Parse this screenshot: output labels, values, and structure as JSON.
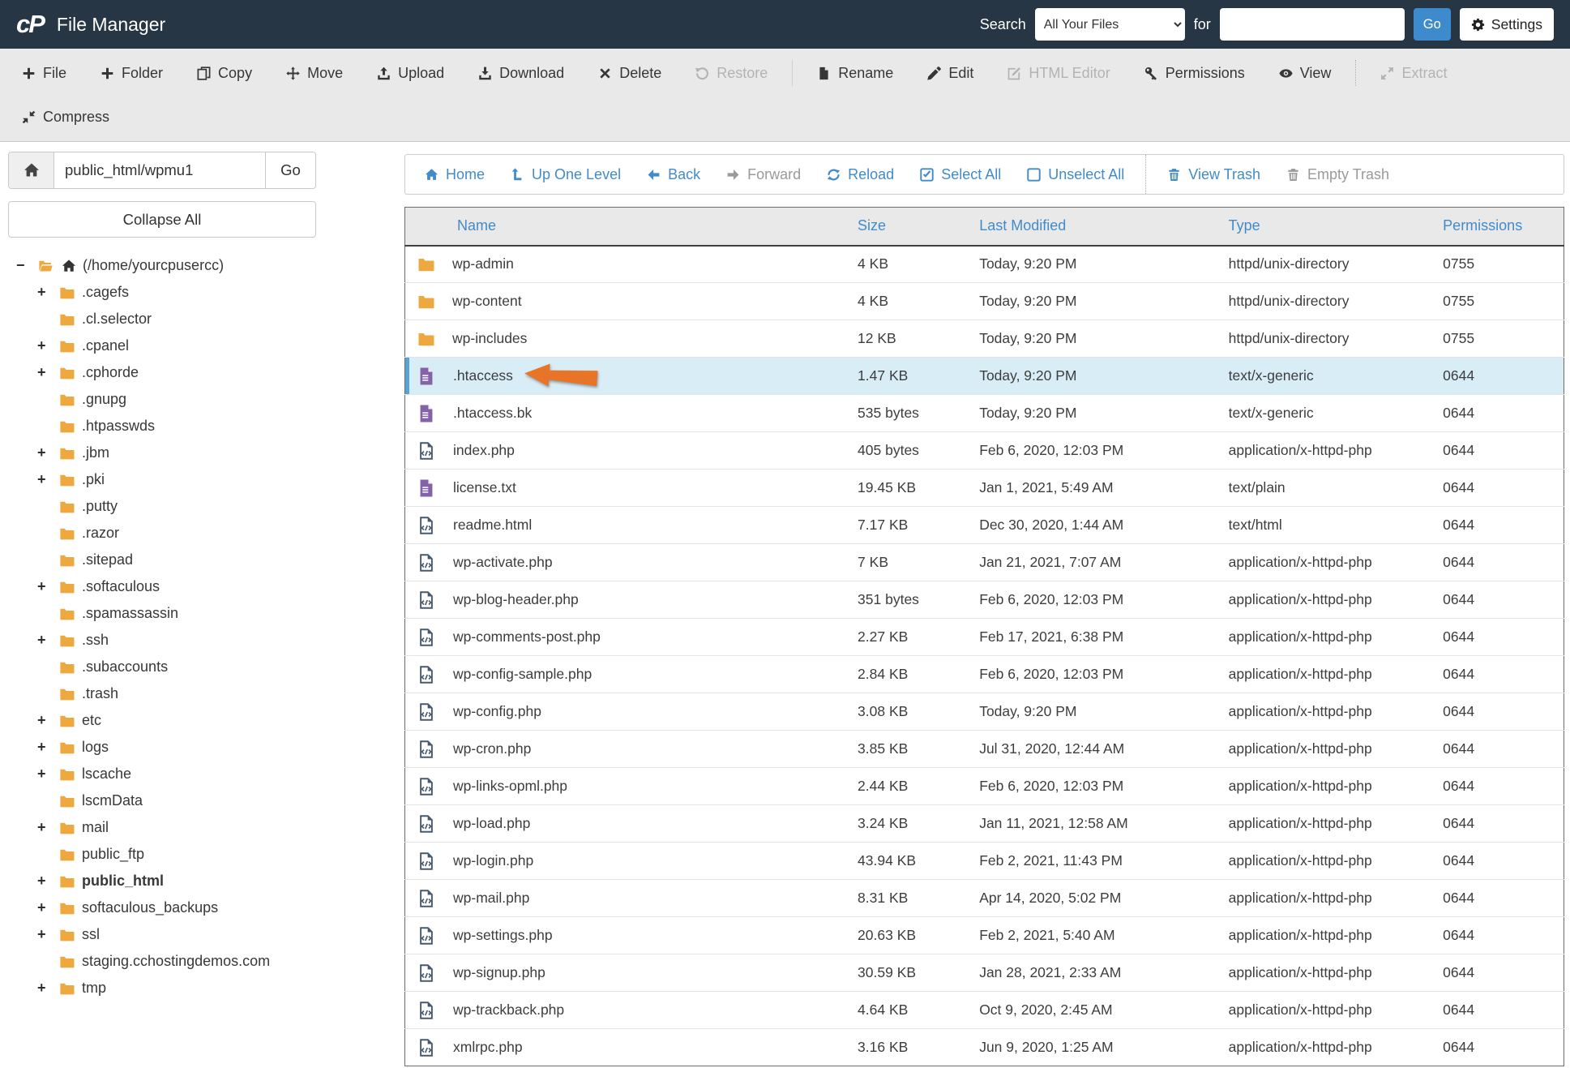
{
  "header": {
    "logo_text": "cP",
    "app_title": "File Manager",
    "search_label": "Search",
    "search_scope": "All Your Files",
    "for_label": "for",
    "search_value": "",
    "go_label": "Go",
    "settings_label": "Settings"
  },
  "colors": {
    "header_bg": "#263645",
    "accent_blue": "#428bca",
    "go_button_blue": "#3d8bcd",
    "folder_orange": "#eda93f",
    "doc_purple": "#8362a8",
    "code_navy": "#47596d",
    "selected_row_bg": "#d9edf7",
    "selected_row_bar": "#57a4d5",
    "annotation_arrow": "#e87427",
    "toolbar_bg": "#e9e9e9"
  },
  "action_toolbar": {
    "row1": [
      {
        "label": "File",
        "icon": "plus",
        "enabled": true
      },
      {
        "label": "Folder",
        "icon": "plus",
        "enabled": true
      },
      {
        "label": "Copy",
        "icon": "copy",
        "enabled": true
      },
      {
        "label": "Move",
        "icon": "move",
        "enabled": true
      },
      {
        "label": "Upload",
        "icon": "upload",
        "enabled": true
      },
      {
        "label": "Download",
        "icon": "download",
        "enabled": true
      },
      {
        "label": "Delete",
        "icon": "x",
        "enabled": true
      },
      {
        "label": "Restore",
        "icon": "restore",
        "enabled": false
      },
      {
        "divider": "solid"
      },
      {
        "label": "Rename",
        "icon": "page",
        "enabled": true
      },
      {
        "label": "Edit",
        "icon": "pencil",
        "enabled": true
      },
      {
        "label": "HTML Editor",
        "icon": "pencil-square",
        "enabled": false
      },
      {
        "label": "Permissions",
        "icon": "key",
        "enabled": true
      },
      {
        "label": "View",
        "icon": "eye",
        "enabled": true
      },
      {
        "divider": "dotted"
      },
      {
        "label": "Extract",
        "icon": "extract",
        "enabled": false
      }
    ],
    "row2": [
      {
        "label": "Compress",
        "icon": "compress",
        "enabled": true
      }
    ]
  },
  "sidebar": {
    "path_value": "public_html/wpmu1",
    "go_label": "Go",
    "collapse_all_label": "Collapse All",
    "tree": [
      {
        "label": "(/home/yourcpusercc)",
        "depth": 0,
        "toggle": "-",
        "open": true,
        "home": true,
        "bold": false
      },
      {
        "label": ".cagefs",
        "depth": 1,
        "toggle": "+"
      },
      {
        "label": ".cl.selector",
        "depth": 1,
        "toggle": ""
      },
      {
        "label": ".cpanel",
        "depth": 1,
        "toggle": "+"
      },
      {
        "label": ".cphorde",
        "depth": 1,
        "toggle": "+"
      },
      {
        "label": ".gnupg",
        "depth": 1,
        "toggle": ""
      },
      {
        "label": ".htpasswds",
        "depth": 1,
        "toggle": ""
      },
      {
        "label": ".jbm",
        "depth": 1,
        "toggle": "+"
      },
      {
        "label": ".pki",
        "depth": 1,
        "toggle": "+"
      },
      {
        "label": ".putty",
        "depth": 1,
        "toggle": ""
      },
      {
        "label": ".razor",
        "depth": 1,
        "toggle": ""
      },
      {
        "label": ".sitepad",
        "depth": 1,
        "toggle": ""
      },
      {
        "label": ".softaculous",
        "depth": 1,
        "toggle": "+"
      },
      {
        "label": ".spamassassin",
        "depth": 1,
        "toggle": ""
      },
      {
        "label": ".ssh",
        "depth": 1,
        "toggle": "+"
      },
      {
        "label": ".subaccounts",
        "depth": 1,
        "toggle": ""
      },
      {
        "label": ".trash",
        "depth": 1,
        "toggle": ""
      },
      {
        "label": "etc",
        "depth": 1,
        "toggle": "+"
      },
      {
        "label": "logs",
        "depth": 1,
        "toggle": "+"
      },
      {
        "label": "lscache",
        "depth": 1,
        "toggle": "+"
      },
      {
        "label": "lscmData",
        "depth": 1,
        "toggle": ""
      },
      {
        "label": "mail",
        "depth": 1,
        "toggle": "+"
      },
      {
        "label": "public_ftp",
        "depth": 1,
        "toggle": ""
      },
      {
        "label": "public_html",
        "depth": 1,
        "toggle": "+",
        "bold": true
      },
      {
        "label": "softaculous_backups",
        "depth": 1,
        "toggle": "+"
      },
      {
        "label": "ssl",
        "depth": 1,
        "toggle": "+"
      },
      {
        "label": "staging.cchostingdemos.com",
        "depth": 1,
        "toggle": ""
      },
      {
        "label": "tmp",
        "depth": 1,
        "toggle": "+"
      }
    ]
  },
  "filebrowser": {
    "nav": [
      {
        "label": "Home",
        "icon": "home",
        "enabled": true
      },
      {
        "label": "Up One Level",
        "icon": "up-level",
        "enabled": true
      },
      {
        "label": "Back",
        "icon": "arrow-left",
        "enabled": true
      },
      {
        "label": "Forward",
        "icon": "arrow-right",
        "enabled": false
      },
      {
        "label": "Reload",
        "icon": "reload",
        "enabled": true
      },
      {
        "label": "Select All",
        "icon": "check-square",
        "enabled": true
      },
      {
        "label": "Unselect All",
        "icon": "square",
        "enabled": true
      },
      {
        "divider": "dotted"
      },
      {
        "label": "View Trash",
        "icon": "trash",
        "enabled": true
      },
      {
        "label": "Empty Trash",
        "icon": "trash",
        "enabled": false
      }
    ],
    "columns": [
      "Name",
      "Size",
      "Last Modified",
      "Type",
      "Permissions"
    ],
    "rows": [
      {
        "name": "wp-admin",
        "icon": "folder",
        "size": "4 KB",
        "modified": "Today, 9:20 PM",
        "type": "httpd/unix-directory",
        "perms": "0755"
      },
      {
        "name": "wp-content",
        "icon": "folder",
        "size": "4 KB",
        "modified": "Today, 9:20 PM",
        "type": "httpd/unix-directory",
        "perms": "0755"
      },
      {
        "name": "wp-includes",
        "icon": "folder",
        "size": "12 KB",
        "modified": "Today, 9:20 PM",
        "type": "httpd/unix-directory",
        "perms": "0755"
      },
      {
        "name": ".htaccess",
        "icon": "doc",
        "size": "1.47 KB",
        "modified": "Today, 9:20 PM",
        "type": "text/x-generic",
        "perms": "0644",
        "selected": true,
        "arrow": true
      },
      {
        "name": ".htaccess.bk",
        "icon": "doc",
        "size": "535 bytes",
        "modified": "Today, 9:20 PM",
        "type": "text/x-generic",
        "perms": "0644"
      },
      {
        "name": "index.php",
        "icon": "code",
        "size": "405 bytes",
        "modified": "Feb 6, 2020, 12:03 PM",
        "type": "application/x-httpd-php",
        "perms": "0644"
      },
      {
        "name": "license.txt",
        "icon": "doc",
        "size": "19.45 KB",
        "modified": "Jan 1, 2021, 5:49 AM",
        "type": "text/plain",
        "perms": "0644"
      },
      {
        "name": "readme.html",
        "icon": "code",
        "size": "7.17 KB",
        "modified": "Dec 30, 2020, 1:44 AM",
        "type": "text/html",
        "perms": "0644"
      },
      {
        "name": "wp-activate.php",
        "icon": "code",
        "size": "7 KB",
        "modified": "Jan 21, 2021, 7:07 AM",
        "type": "application/x-httpd-php",
        "perms": "0644"
      },
      {
        "name": "wp-blog-header.php",
        "icon": "code",
        "size": "351 bytes",
        "modified": "Feb 6, 2020, 12:03 PM",
        "type": "application/x-httpd-php",
        "perms": "0644"
      },
      {
        "name": "wp-comments-post.php",
        "icon": "code",
        "size": "2.27 KB",
        "modified": "Feb 17, 2021, 6:38 PM",
        "type": "application/x-httpd-php",
        "perms": "0644"
      },
      {
        "name": "wp-config-sample.php",
        "icon": "code",
        "size": "2.84 KB",
        "modified": "Feb 6, 2020, 12:03 PM",
        "type": "application/x-httpd-php",
        "perms": "0644"
      },
      {
        "name": "wp-config.php",
        "icon": "code",
        "size": "3.08 KB",
        "modified": "Today, 9:20 PM",
        "type": "application/x-httpd-php",
        "perms": "0644"
      },
      {
        "name": "wp-cron.php",
        "icon": "code",
        "size": "3.85 KB",
        "modified": "Jul 31, 2020, 12:44 AM",
        "type": "application/x-httpd-php",
        "perms": "0644"
      },
      {
        "name": "wp-links-opml.php",
        "icon": "code",
        "size": "2.44 KB",
        "modified": "Feb 6, 2020, 12:03 PM",
        "type": "application/x-httpd-php",
        "perms": "0644"
      },
      {
        "name": "wp-load.php",
        "icon": "code",
        "size": "3.24 KB",
        "modified": "Jan 11, 2021, 12:58 AM",
        "type": "application/x-httpd-php",
        "perms": "0644"
      },
      {
        "name": "wp-login.php",
        "icon": "code",
        "size": "43.94 KB",
        "modified": "Feb 2, 2021, 11:43 PM",
        "type": "application/x-httpd-php",
        "perms": "0644"
      },
      {
        "name": "wp-mail.php",
        "icon": "code",
        "size": "8.31 KB",
        "modified": "Apr 14, 2020, 5:02 PM",
        "type": "application/x-httpd-php",
        "perms": "0644"
      },
      {
        "name": "wp-settings.php",
        "icon": "code",
        "size": "20.63 KB",
        "modified": "Feb 2, 2021, 5:40 AM",
        "type": "application/x-httpd-php",
        "perms": "0644"
      },
      {
        "name": "wp-signup.php",
        "icon": "code",
        "size": "30.59 KB",
        "modified": "Jan 28, 2021, 2:33 AM",
        "type": "application/x-httpd-php",
        "perms": "0644"
      },
      {
        "name": "wp-trackback.php",
        "icon": "code",
        "size": "4.64 KB",
        "modified": "Oct 9, 2020, 2:45 AM",
        "type": "application/x-httpd-php",
        "perms": "0644"
      },
      {
        "name": "xmlrpc.php",
        "icon": "code",
        "size": "3.16 KB",
        "modified": "Jun 9, 2020, 1:25 AM",
        "type": "application/x-httpd-php",
        "perms": "0644"
      }
    ]
  }
}
